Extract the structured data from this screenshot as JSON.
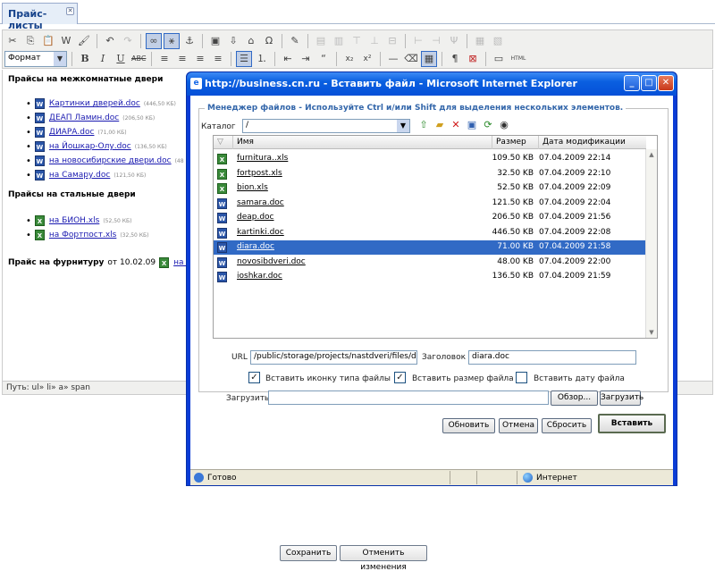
{
  "tab": {
    "label": "Прайс-листы"
  },
  "editor": {
    "format_label": "Формат",
    "sections": [
      {
        "title": "Прайсы на межкомнатные двери",
        "items": [
          {
            "type": "doc",
            "label": "Картинки дверей.doc",
            "size": "(446,50 КБ)"
          },
          {
            "type": "doc",
            "label": "ДЕАП Ламин.doc",
            "size": "(206,50 КБ)"
          },
          {
            "type": "doc",
            "label": "ДИАРА.doc",
            "size": "(71,00 КБ)"
          },
          {
            "type": "doc",
            "label": "на Йошкар-Олу.doc",
            "size": "(136,50 КБ)"
          },
          {
            "type": "doc",
            "label": "на новосибирские двери.doc",
            "size": "(48"
          },
          {
            "type": "doc",
            "label": "на Самару.doc",
            "size": "(121,50 КБ)"
          }
        ]
      },
      {
        "title": "Прайсы на стальные двери",
        "items": [
          {
            "type": "xls",
            "label": "на БИОН.xls",
            "size": "(52,50 КБ)"
          },
          {
            "type": "xls",
            "label": "на Фортпост.xls",
            "size": "(32,50 КБ)"
          }
        ]
      }
    ],
    "furniture_title": "Прайс на фурнитуру",
    "furniture_date": "от 10.02.09",
    "furniture_link": "на фу",
    "path": "Путь: ul» li» a» span",
    "save_label": "Сохранить",
    "revert_label": "Отменить изменения"
  },
  "ie_window": {
    "title": "http://business.cn.ru - Вставить файл - Microsoft Internet Explorer",
    "status_left": "Готово",
    "status_right": "Интернет"
  },
  "file_manager": {
    "legend": "Менеджер файлов - Используйте Ctrl и/или Shift для выделения нескольких элементов.",
    "catalog_label": "Каталог",
    "catalog_value": "/",
    "columns": {
      "name": "Имя",
      "size": "Размер",
      "date": "Дата модификации"
    },
    "files": [
      {
        "type": "xls",
        "name": "furnitura..xls",
        "size": "109.50 KB",
        "date": "07.04.2009 22:14"
      },
      {
        "type": "xls",
        "name": "fortpost.xls",
        "size": "32.50 KB",
        "date": "07.04.2009 22:10"
      },
      {
        "type": "xls",
        "name": "bion.xls",
        "size": "52.50 KB",
        "date": "07.04.2009 22:09"
      },
      {
        "type": "doc",
        "name": "samara.doc",
        "size": "121.50 KB",
        "date": "07.04.2009 22:04"
      },
      {
        "type": "doc",
        "name": "deap.doc",
        "size": "206.50 KB",
        "date": "07.04.2009 21:56"
      },
      {
        "type": "doc",
        "name": "kartinki.doc",
        "size": "446.50 KB",
        "date": "07.04.2009 22:08"
      },
      {
        "type": "doc",
        "name": "diara.doc",
        "size": "71.00 KB",
        "date": "07.04.2009 21:58",
        "selected": true
      },
      {
        "type": "doc",
        "name": "novosibdveri.doc",
        "size": "48.00 KB",
        "date": "07.04.2009 22:00"
      },
      {
        "type": "doc",
        "name": "ioshkar.doc",
        "size": "136.50 KB",
        "date": "07.04.2009 21:59"
      }
    ],
    "url_label": "URL",
    "url_value": "/public/storage/projects/nastdveri/files/diara.doc",
    "heading_label": "Заголовок",
    "heading_value": "diara.doc",
    "opt_icon": {
      "label": "Вставить иконку типа файлы",
      "checked": true
    },
    "opt_size": {
      "label": "Вставить размер файла",
      "checked": true
    },
    "opt_date": {
      "label": "Вставить дату файла",
      "checked": false
    },
    "upload_label": "Загрузить",
    "browse_label": "Обзор...",
    "upload_button": "Загрузить",
    "refresh_label": "Обновить",
    "cancel_label": "Отмена",
    "reset_label": "Сбросить",
    "insert_label": "Вставить"
  }
}
